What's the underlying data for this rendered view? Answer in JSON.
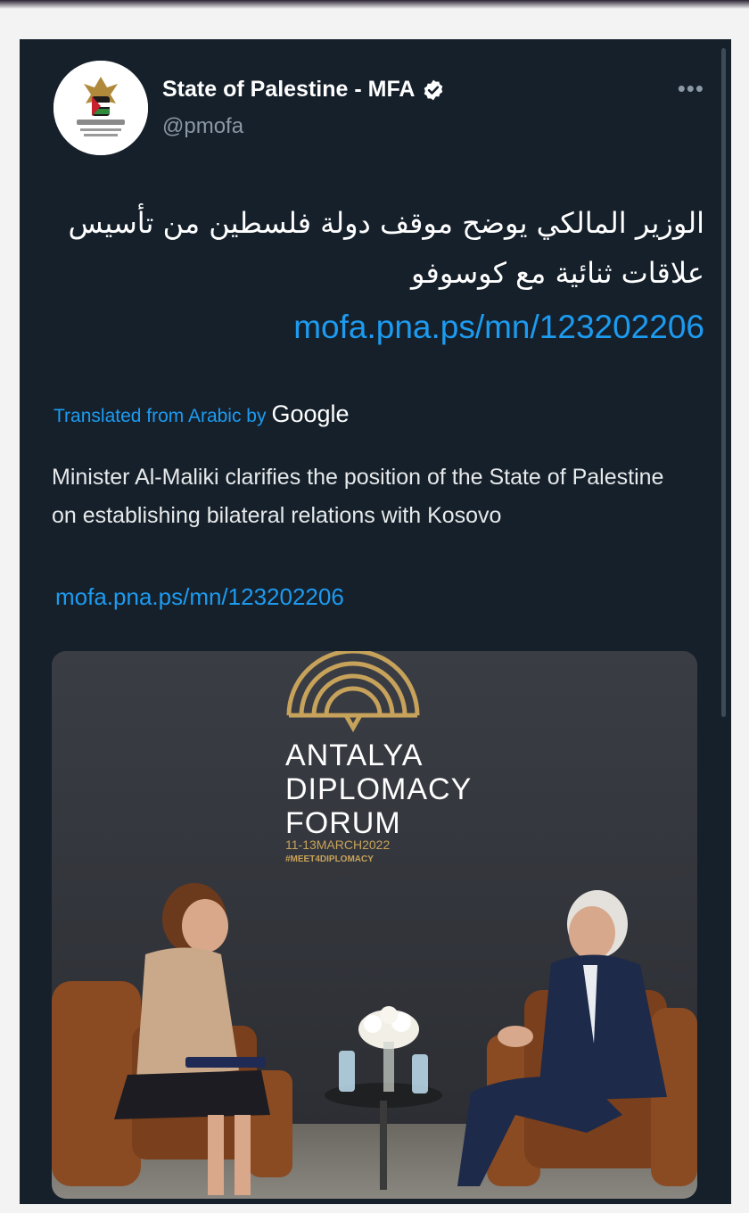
{
  "tweet": {
    "display_name": "State of Palestine - MFA",
    "handle": "@pmofa",
    "more_icon": "more-horizontal-icon",
    "verified_icon": "verified-badge-icon",
    "arabic_text": "الوزير المالكي يوضح موقف دولة فلسطين من تأسيس علاقات ثنائية مع كوسوفو",
    "link": "mofa.pna.ps/mn/123202206",
    "translated_label": "Translated from Arabic by",
    "translated_provider": "Google",
    "translation": "Minister Al-Maliki clarifies the position of the State of Palestine on establishing bilateral relations with Kosovo",
    "translation_link": "mofa.pna.ps/mn/123202206"
  },
  "photo": {
    "sign_line1": "ANTALYA",
    "sign_line2": "DIPLOMACY",
    "sign_line3": "FORUM",
    "sign_dates": "11-13MARCH2022",
    "sign_hashtag": "#MEET4DIPLOMACY"
  },
  "colors": {
    "background": "#15202b",
    "link": "#1d9bf0",
    "muted": "#8b98a5",
    "sign_gold": "#c7a25a"
  }
}
